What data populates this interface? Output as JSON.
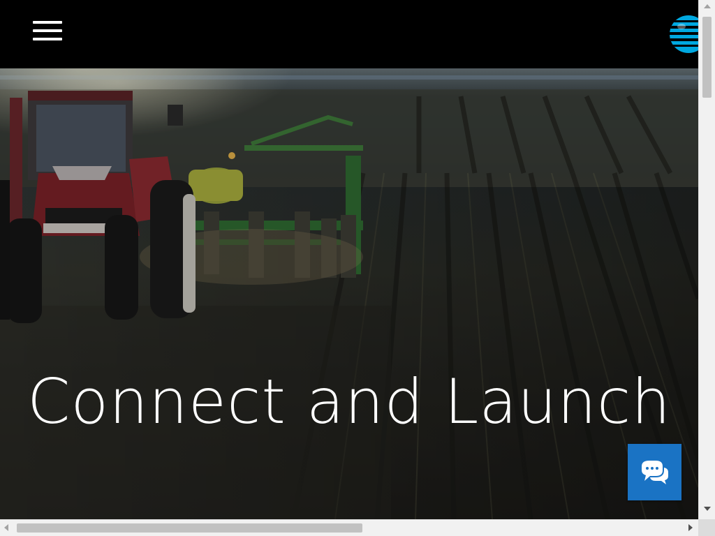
{
  "header": {
    "menu_icon": "hamburger-menu-icon",
    "logo_icon": "att-globe-logo-icon",
    "brand_color": "#00a8e0"
  },
  "hero": {
    "title": "Connect and Launch",
    "background": "tractor-planting-field-photo"
  },
  "chat": {
    "icon": "chat-bubbles-icon",
    "color": "#1a73c4"
  },
  "scrollbars": {
    "vertical_icon_up": "scroll-up-arrow-icon",
    "vertical_icon_down": "scroll-down-arrow-icon",
    "horizontal_icon_left": "scroll-left-arrow-icon",
    "horizontal_icon_right": "scroll-right-arrow-icon"
  }
}
